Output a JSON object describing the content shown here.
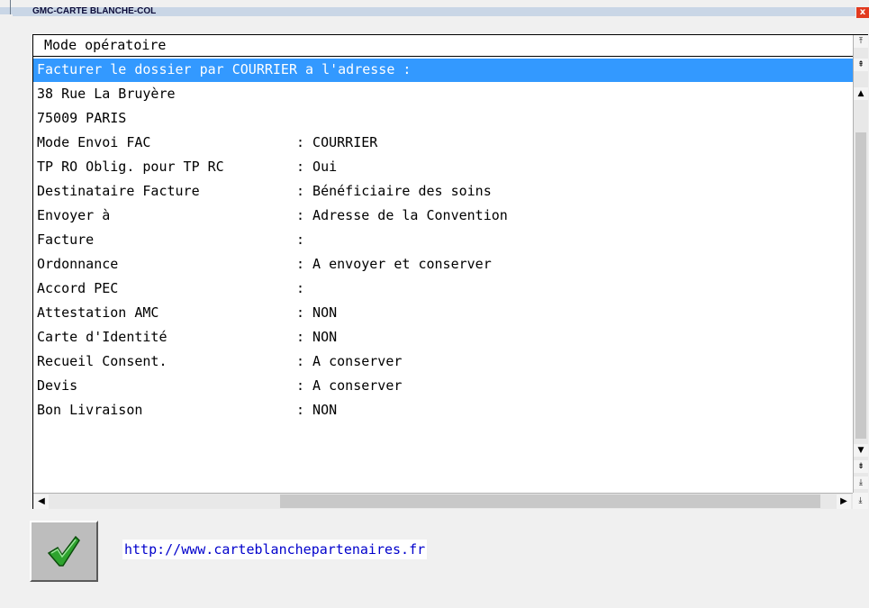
{
  "window": {
    "title": "GMC-CARTE BLANCHE-COL",
    "close_glyph": "x"
  },
  "panel": {
    "header": "Mode opératoire",
    "rows": [
      {
        "key": "Facturer le dossier par COURRIER a l'adresse :",
        "value": "",
        "selected": true
      },
      {
        "key": "38 Rue La Bruyère",
        "value": ""
      },
      {
        "key": "75009 PARIS",
        "value": ""
      },
      {
        "key": "Mode Envoi FAC",
        "value": ": COURRIER"
      },
      {
        "key": "TP RO Oblig. pour TP RC",
        "value": ": Oui"
      },
      {
        "key": "Destinataire Facture",
        "value": ": Bénéficiaire des soins"
      },
      {
        "key": "Envoyer à",
        "value": ": Adresse de la Convention"
      },
      {
        "key": "Facture",
        "value": ":"
      },
      {
        "key": "Ordonnance",
        "value": ": A envoyer et conserver"
      },
      {
        "key": "Accord PEC",
        "value": ":"
      },
      {
        "key": "Attestation AMC",
        "value": ": NON"
      },
      {
        "key": "Carte d'Identité",
        "value": ": NON"
      },
      {
        "key": "Recueil Consent.",
        "value": ": A conserver"
      },
      {
        "key": "Devis",
        "value": ": A conserver"
      },
      {
        "key": "Bon Livraison",
        "value": ": NON"
      }
    ]
  },
  "footer": {
    "ok_icon": "checkmark-icon",
    "link": "http://www.carteblanchepartenaires.fr"
  },
  "colors": {
    "selection": "#3399ff",
    "link": "#0000cc",
    "close": "#e23a1f",
    "titlebar": "#c9d6e6",
    "check": "#2ea32e"
  }
}
